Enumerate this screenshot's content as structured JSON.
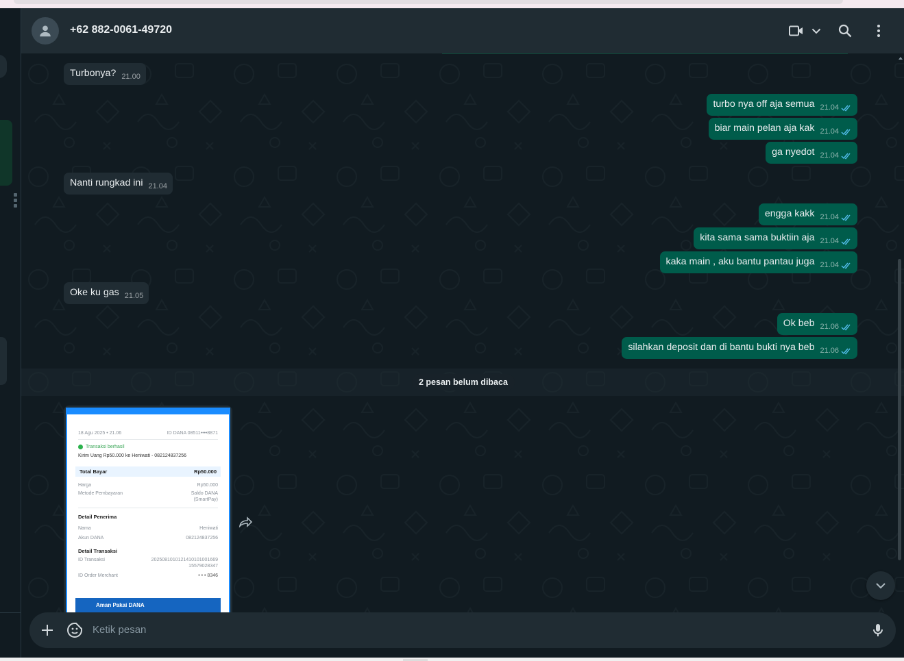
{
  "header": {
    "contact_name": "+62 882-0061-49720"
  },
  "messages": [
    {
      "dir": "in",
      "text": "Turbonya?",
      "time": "21.00"
    },
    {
      "dir": "out",
      "text": "turbo nya off aja semua",
      "time": "21.04"
    },
    {
      "dir": "out",
      "text": "biar main pelan aja kak",
      "time": "21.04"
    },
    {
      "dir": "out",
      "text": "ga nyedot",
      "time": "21.04"
    },
    {
      "dir": "in",
      "text": "Nanti rungkad ini",
      "time": "21.04"
    },
    {
      "dir": "out",
      "text": "engga kakk",
      "time": "21.04"
    },
    {
      "dir": "out",
      "text": "kita sama sama buktiin aja",
      "time": "21.04"
    },
    {
      "dir": "out",
      "text": "kaka main , aku bantu pantau juga",
      "time": "21.04"
    },
    {
      "dir": "in",
      "text": "Oke ku gas",
      "time": "21.05"
    },
    {
      "dir": "out",
      "text": "Ok beb",
      "time": "21.06"
    },
    {
      "dir": "out",
      "text": "silahkan deposit dan di bantu bukti nya beb",
      "time": "21.06"
    }
  ],
  "unread_label": "2 pesan belum dibaca",
  "receipt": {
    "date": "18 Agu 2025 • 21.06",
    "dana_id": "ID DANA 08511••••8871",
    "status": "Transaksi berhasil",
    "description": "Kirim Uang Rp50.000 ke Heniwati - 082124837256",
    "total_label": "Total Bayar",
    "total_value": "Rp50.000",
    "harga_label": "Harga",
    "harga_value": "Rp50.000",
    "metode_label": "Metode Pembayaran",
    "metode_value_1": "Saldo DANA",
    "metode_value_2": "(SmartPay)",
    "penerima_title": "Detail Penerima",
    "nama_label": "Nama",
    "nama_value": "Heniwati",
    "akun_label": "Akun DANA",
    "akun_value": "082124837256",
    "transaksi_title": "Detail Transaksi",
    "id_transaksi_label": "ID Transaksi",
    "id_transaksi_value_1": "2025081010121410101001669",
    "id_transaksi_value_2": "15579028347",
    "id_order_label": "ID Order Merchant",
    "id_order_value": "• • • 8346",
    "banner": "Aman Pakai DANA"
  },
  "composer": {
    "placeholder": "Ketik pesan"
  },
  "colors": {
    "incoming": "#202c33",
    "outgoing": "#005c4b",
    "tick_read": "#53bdeb"
  },
  "icons": [
    "user-icon",
    "video-call-icon",
    "chevron-down-icon",
    "search-icon",
    "menu-icon",
    "forward-icon",
    "plus-icon",
    "sticker-icon",
    "mic-icon"
  ]
}
